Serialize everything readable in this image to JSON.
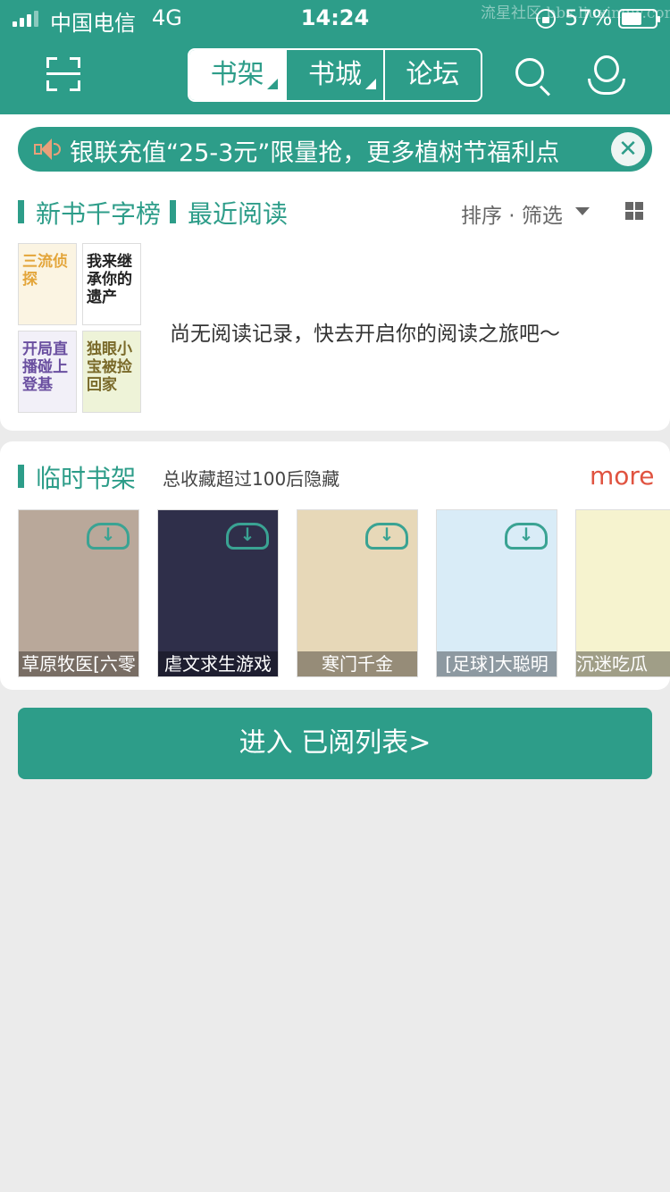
{
  "status_bar": {
    "carrier": "中国电信",
    "network": "4G",
    "time": "14:24",
    "battery": "57%",
    "watermark": "流星社区 bbs.liuxingw.com"
  },
  "header": {
    "tabs": [
      {
        "label": "书架",
        "active": true
      },
      {
        "label": "书城",
        "active": false
      },
      {
        "label": "论坛",
        "active": false
      }
    ],
    "icons": [
      "scan-icon",
      "search-icon",
      "user-icon"
    ]
  },
  "banner": {
    "text": "银联充值“25-3元”限量抢，更多植树节福利点"
  },
  "recent": {
    "tab1": "新书千字榜",
    "tab2": "最近阅读",
    "sort_label": "排序 · 筛选",
    "empty_message": "尚无阅读记录，快去开启你的阅读之旅吧～",
    "covers": [
      {
        "text": "三流侦探",
        "color": "#e3a53a",
        "bg": "#fbf4e2"
      },
      {
        "text": "我来继承你的遗产",
        "color": "#222222",
        "bg": "#ffffff"
      },
      {
        "text": "开局直播碰上登基",
        "color": "#6a4fa0",
        "bg": "#f2f0f8"
      },
      {
        "text": "独眼小宝被捡回家",
        "color": "#7a6a2a",
        "bg": "#eef3d8"
      }
    ]
  },
  "temp_shelf": {
    "title": "临时书架",
    "note": "总收藏超过100后隐藏",
    "more": "more",
    "books": [
      {
        "title": "草原牧医[六零",
        "bg": "#b9a89a",
        "art_color": "#2e5d3a"
      },
      {
        "title": "虐文求生游戏",
        "bg": "#2f2f4a",
        "art_color": "#e8e8f0"
      },
      {
        "title": "寒门千金",
        "bg": "#e7d8b8",
        "art_color": "#5a3a28"
      },
      {
        "title": "[足球]大聪明",
        "bg": "#d9ecf7",
        "art_color": "#2b7fd0"
      },
      {
        "title": "沉迷吃瓜",
        "bg": "#f6f3cf",
        "art_color": "#333333"
      }
    ]
  },
  "footer": {
    "enter_label": "进入 已阅列表>"
  }
}
